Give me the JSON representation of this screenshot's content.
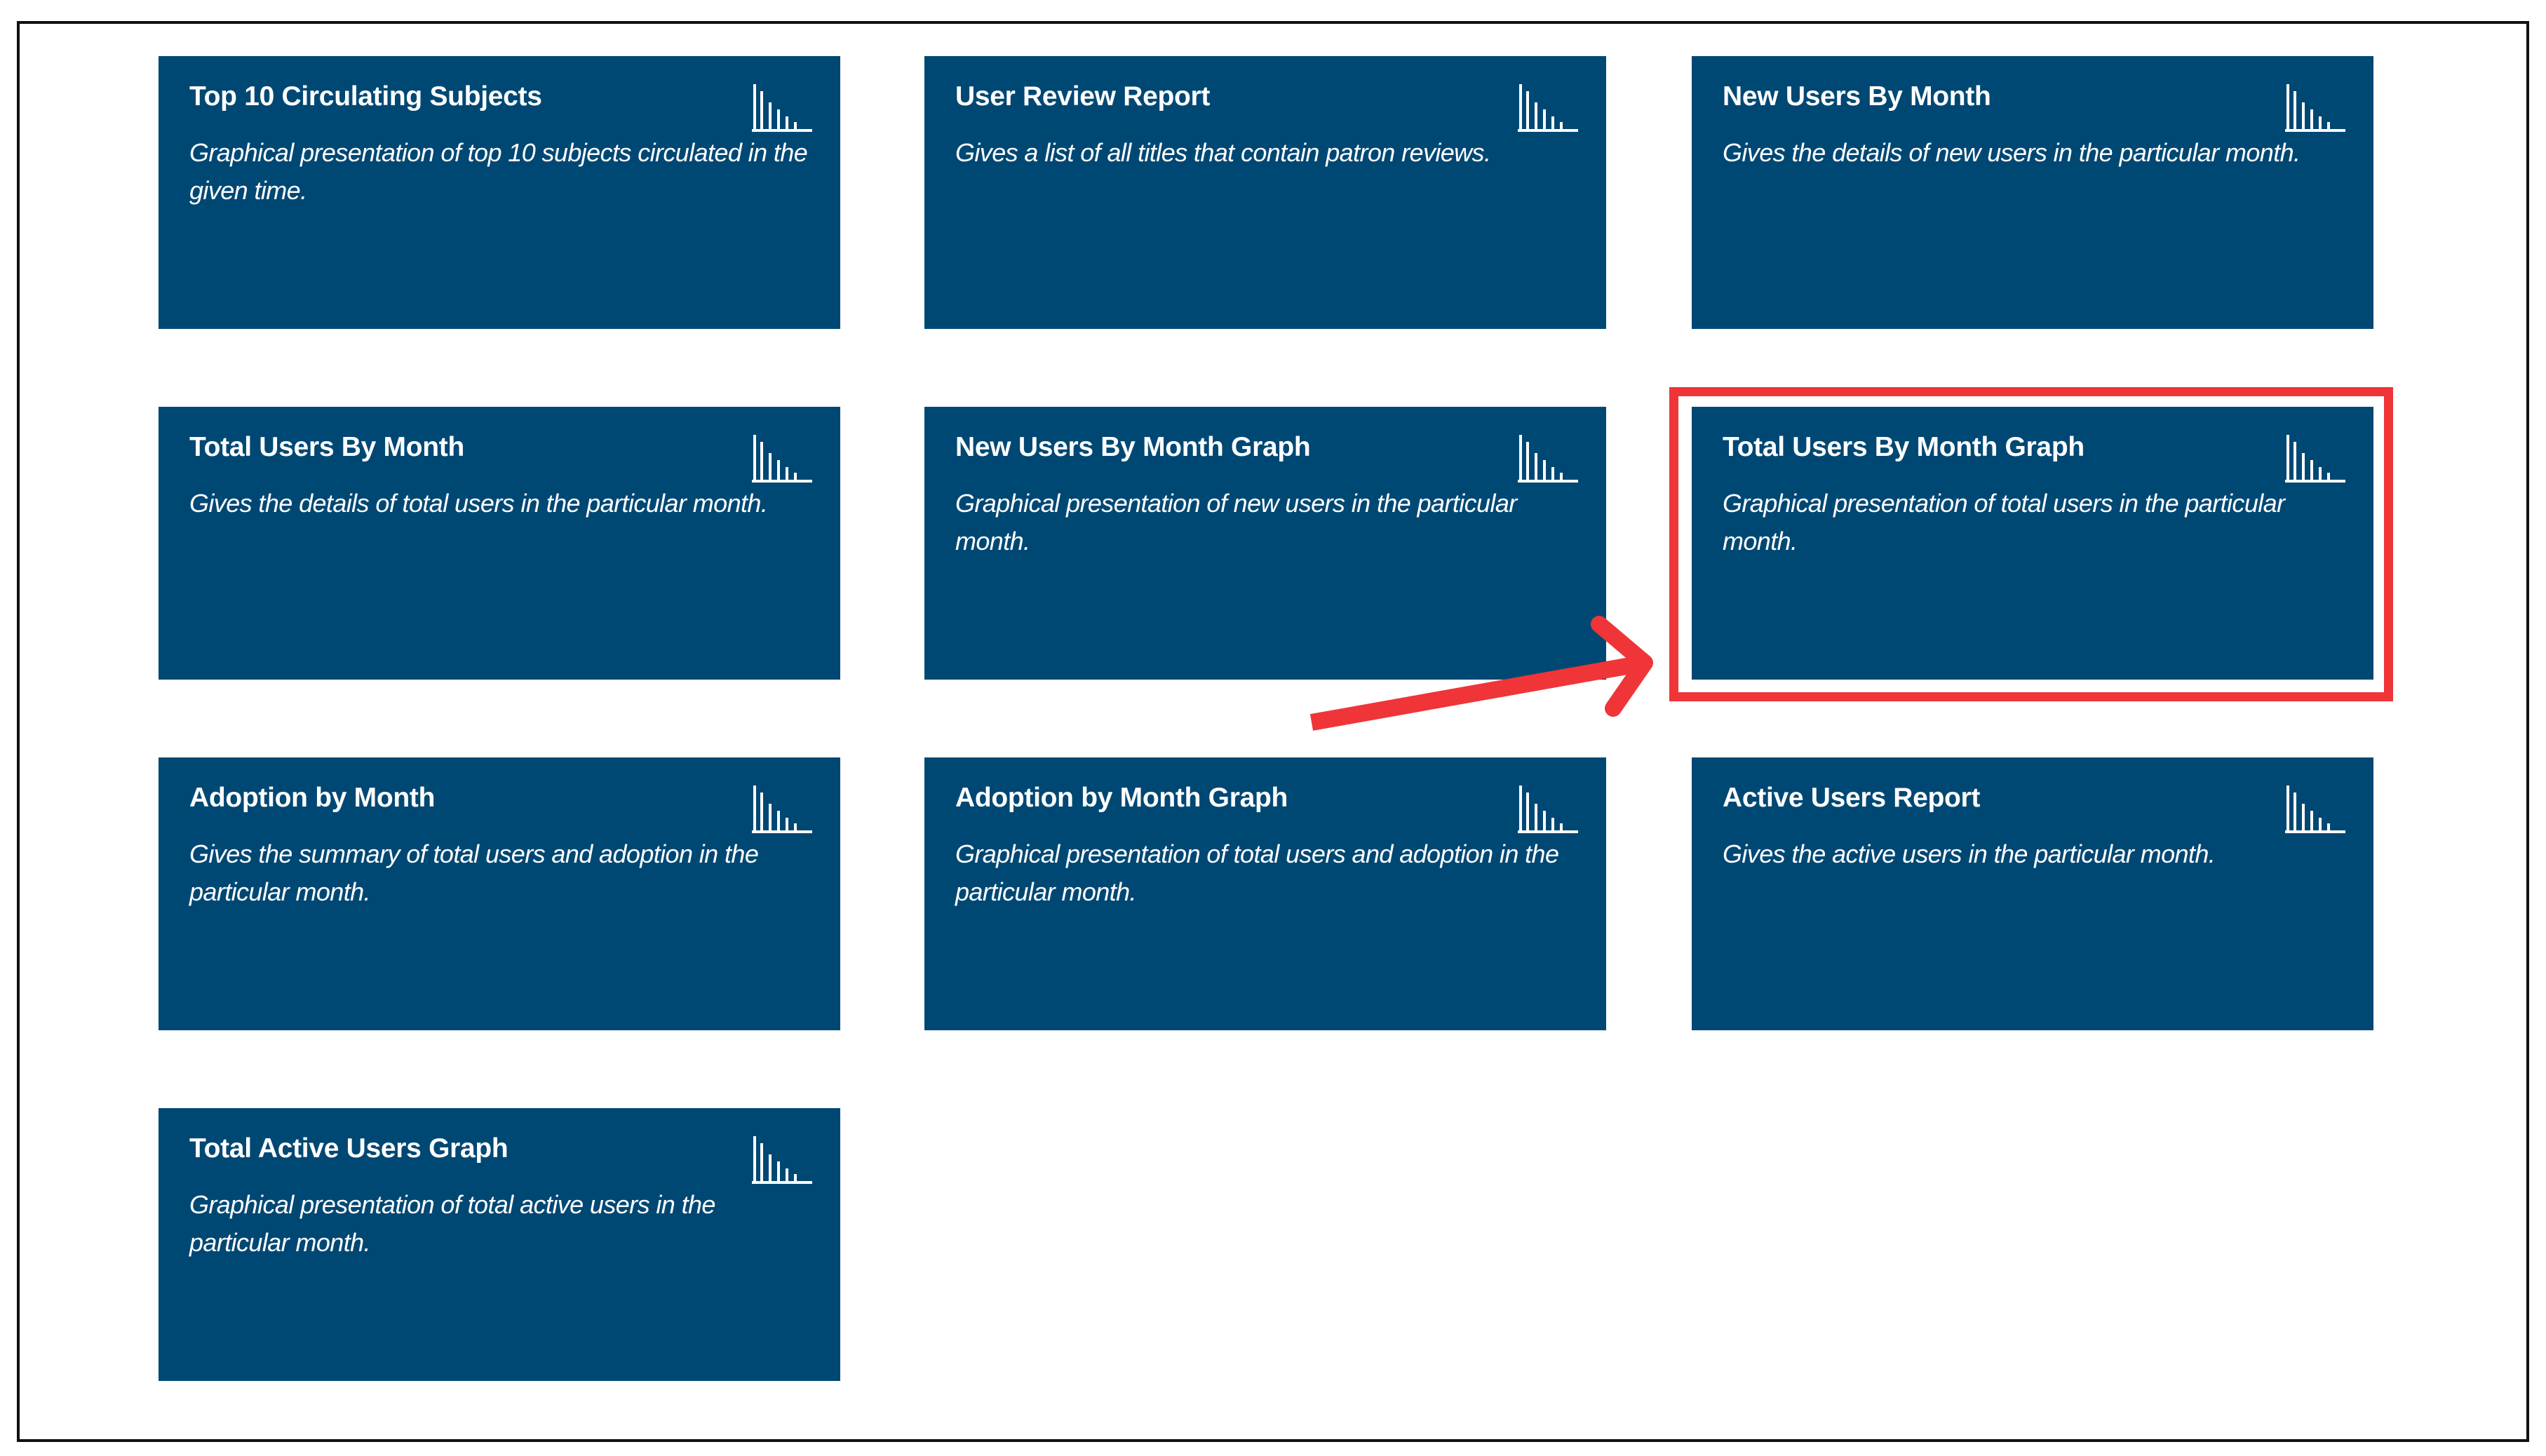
{
  "colors": {
    "tile_bg": "#004874",
    "tile_text": "#ffffff",
    "highlight": "#ef3538",
    "frame_border": "#111111"
  },
  "tiles": [
    {
      "title": "Top 10 Circulating Subjects",
      "description": "Graphical presentation of top 10 subjects circulated in the given time.",
      "icon": "bar-chart-icon"
    },
    {
      "title": "User Review Report",
      "description": "Gives a list of all titles that contain patron reviews.",
      "icon": "bar-chart-icon"
    },
    {
      "title": "New Users By Month",
      "description": "Gives the details of new users in the particular month.",
      "icon": "bar-chart-icon"
    },
    {
      "title": "Total Users By Month",
      "description": "Gives the details of total users in the particular month.",
      "icon": "bar-chart-icon"
    },
    {
      "title": "New Users By Month Graph",
      "description": "Graphical presentation of new users in the particular month.",
      "icon": "bar-chart-icon"
    },
    {
      "title": "Total Users By Month Graph",
      "description": "Graphical presentation of total users in the particular month.",
      "icon": "bar-chart-icon",
      "highlighted": true
    },
    {
      "title": "Adoption by Month",
      "description": "Gives the summary of total users and adoption in the particular month.",
      "icon": "bar-chart-icon"
    },
    {
      "title": "Adoption by Month Graph",
      "description": "Graphical presentation of total users and adoption in the particular month.",
      "icon": "bar-chart-icon"
    },
    {
      "title": "Active Users Report",
      "description": "Gives the active users in the particular month.",
      "icon": "bar-chart-icon"
    },
    {
      "title": "Total Active Users Graph",
      "description": "Graphical presentation of total active users in the particular month.",
      "icon": "bar-chart-icon"
    }
  ]
}
